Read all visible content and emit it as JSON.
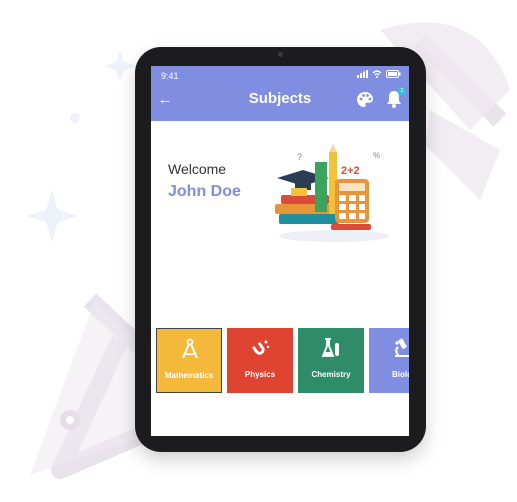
{
  "status_bar": {
    "time": "9:41"
  },
  "header": {
    "title": "Subjects",
    "back_label": "←",
    "notification_count": "2"
  },
  "welcome": {
    "greeting": "Welcome",
    "user_name": "John Doe"
  },
  "subjects": [
    {
      "label": "Mathematics",
      "color": "#f4b93b",
      "icon": "compass-icon",
      "selected": true
    },
    {
      "label": "Physics",
      "color": "#df4433",
      "icon": "magnet-icon"
    },
    {
      "label": "Chemistry",
      "color": "#2e8c68",
      "icon": "flask-icon"
    },
    {
      "label": "Biolo",
      "color": "#7f8ee0",
      "icon": "microscope-icon"
    }
  ],
  "colors": {
    "accent": "#7f8ee0",
    "background_art": "#e8e2ea"
  }
}
